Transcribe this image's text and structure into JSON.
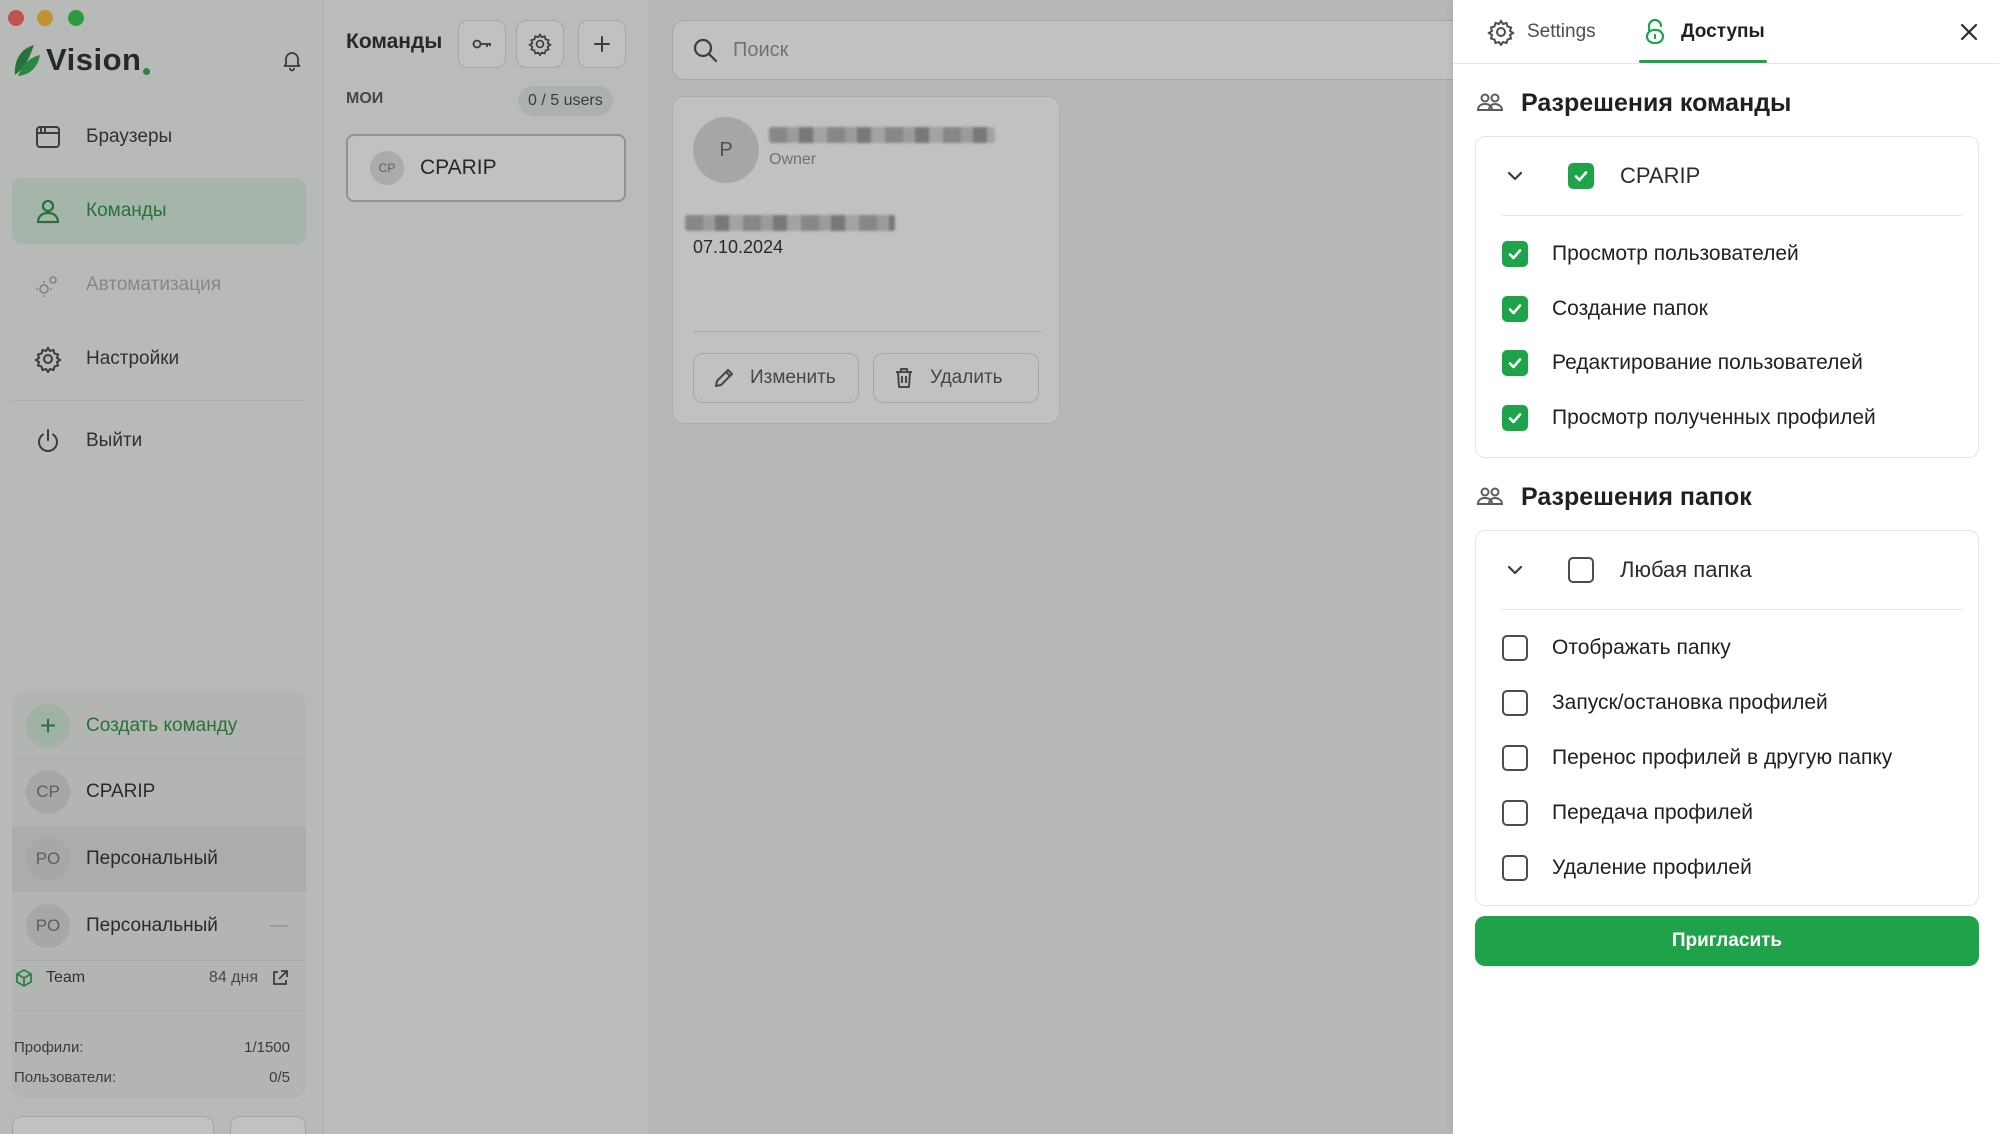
{
  "window": {
    "app_name": "Vision"
  },
  "sidebar": {
    "nav": [
      {
        "label": "Браузеры",
        "icon": "browser-window-icon",
        "state": "normal"
      },
      {
        "label": "Команды",
        "icon": "user-icon",
        "state": "active"
      },
      {
        "label": "Автоматизация",
        "icon": "gears-icon",
        "state": "disabled"
      },
      {
        "label": "Настройки",
        "icon": "gear-icon",
        "state": "normal"
      },
      {
        "label": "Выйти",
        "icon": "power-icon",
        "state": "normal"
      }
    ],
    "team_switcher": {
      "create_label": "Создать команду",
      "teams": [
        {
          "initials": "CP",
          "name": "CPARIP"
        },
        {
          "initials": "PO",
          "name": "Персональный"
        },
        {
          "initials": "PO",
          "name": "Персональный"
        }
      ],
      "plan_name": "Team",
      "plan_days": "84 дня",
      "stats": [
        {
          "label": "Профили:",
          "value": "1/1500"
        },
        {
          "label": "Пользователи:",
          "value": "0/5"
        }
      ]
    }
  },
  "teams_panel": {
    "title": "Команды",
    "section_label": "МОИ",
    "users_count": "0 / 5 users",
    "team": {
      "initials": "CP",
      "name": "CPARIP"
    }
  },
  "content": {
    "search_placeholder": "Поиск",
    "member": {
      "initial": "P",
      "role": "Owner",
      "date": "07.10.2024",
      "edit_label": "Изменить",
      "delete_label": "Удалить"
    }
  },
  "drawer": {
    "tabs": [
      {
        "label": "Settings",
        "icon": "gear-icon",
        "active": false
      },
      {
        "label": "Доступы",
        "icon": "lock-icon",
        "active": true
      }
    ],
    "team_permissions": {
      "title": "Разрешения команды",
      "group": {
        "label": "CPARIP",
        "checked": true
      },
      "items": [
        {
          "label": "Просмотр пользователей",
          "checked": true
        },
        {
          "label": "Создание папок",
          "checked": true
        },
        {
          "label": "Редактирование пользователей",
          "checked": true
        },
        {
          "label": "Просмотр полученных профилей",
          "checked": true
        }
      ]
    },
    "folder_permissions": {
      "title": "Разрешения папок",
      "group": {
        "label": "Любая папка",
        "checked": false
      },
      "items": [
        {
          "label": "Отображать папку",
          "checked": false
        },
        {
          "label": "Запуск/остановка профилей",
          "checked": false
        },
        {
          "label": "Перенос профилей в другую папку",
          "checked": false
        },
        {
          "label": "Передача профилей",
          "checked": false
        },
        {
          "label": "Удаление профилей",
          "checked": false
        }
      ]
    },
    "invite_label": "Пригласить"
  },
  "colors": {
    "accent": "#1fa34a",
    "accent_light": "#d9eedd",
    "overlay": "#3c3e3c"
  }
}
